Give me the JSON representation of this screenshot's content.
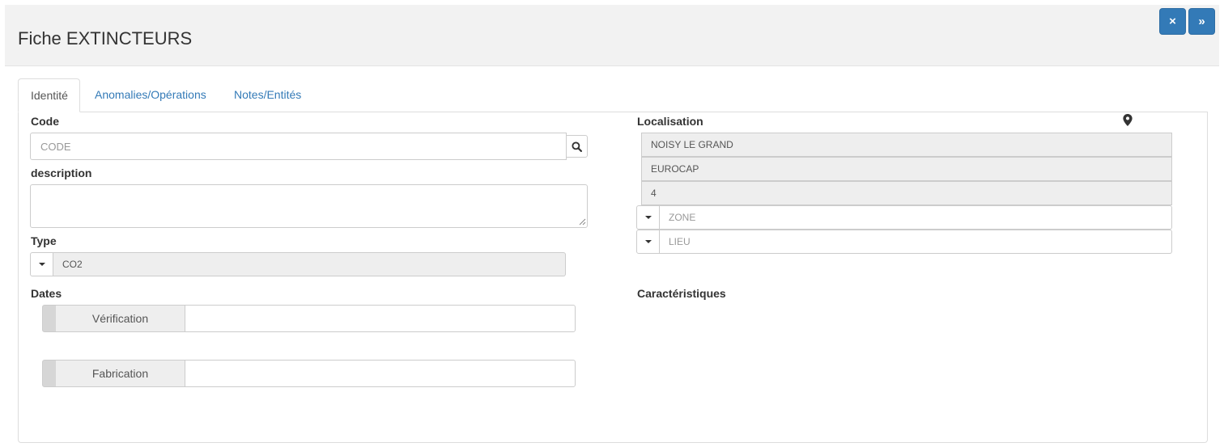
{
  "header": {
    "title": "Fiche EXTINCTEURS",
    "close_label": "×",
    "expand_label": "»"
  },
  "tabs": [
    {
      "label": "Identité",
      "active": true
    },
    {
      "label": "Anomalies/Opérations",
      "active": false
    },
    {
      "label": "Notes/Entités",
      "active": false
    }
  ],
  "form": {
    "code": {
      "label": "Code",
      "placeholder": "CODE",
      "value": ""
    },
    "description": {
      "label": "description",
      "value": ""
    },
    "type": {
      "label": "Type",
      "value": "CO2"
    },
    "dates": {
      "label": "Dates",
      "verification": {
        "label": "Vérification",
        "value": ""
      },
      "fabrication": {
        "label": "Fabrication",
        "value": ""
      }
    },
    "localisation": {
      "label": "Localisation",
      "level1": "NOISY LE GRAND",
      "level2": "EUROCAP",
      "level3": "4",
      "zone_placeholder": "ZONE",
      "lieu_placeholder": "LIEU"
    },
    "caracteristiques": {
      "label": "Caractéristiques"
    }
  },
  "colors": {
    "primary": "#337ab7",
    "link": "#337ab7",
    "header_bg": "#f2f2f2",
    "readonly_bg": "#eeeeee",
    "border": "#cccccc"
  },
  "icons": {
    "search": "search-icon",
    "location": "map-marker-icon",
    "caret": "caret-down-icon"
  }
}
